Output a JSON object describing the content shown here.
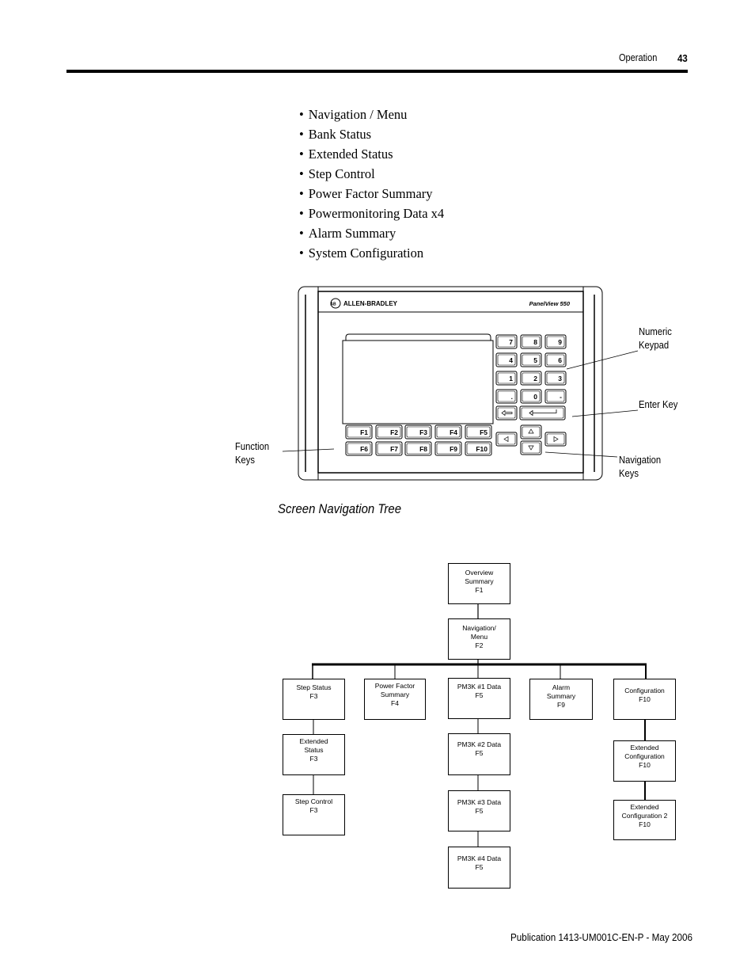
{
  "header": {
    "section": "Operation",
    "page_number": "43"
  },
  "bullet_list": [
    "Navigation / Menu",
    "Bank Status",
    "Extended Status",
    "Step Control",
    "Power Factor Summary",
    "Powermonitoring Data x4",
    "Alarm Summary",
    "System Configuration"
  ],
  "device": {
    "brand": "ALLEN-BRADLEY",
    "brand_logo": "AB",
    "model": "PanelView 550",
    "numeric_keys": [
      "7",
      "8",
      "9",
      "4",
      "5",
      "6",
      "1",
      "2",
      "3",
      ".",
      "0",
      "-"
    ],
    "function_keys_row1": [
      "F1",
      "F2",
      "F3",
      "F4",
      "F5"
    ],
    "function_keys_row2": [
      "F6",
      "F7",
      "F8",
      "F9",
      "F10"
    ],
    "icons": {
      "backspace": "left-arrow-icon",
      "enter": "enter-arrow-icon",
      "up": "up-triangle-icon",
      "down": "down-triangle-icon",
      "left": "left-triangle-icon",
      "right": "right-triangle-icon"
    },
    "callouts": {
      "numeric_keypad": [
        "Numeric",
        "Keypad"
      ],
      "enter_key": "Enter Key",
      "function_keys": [
        "Function",
        "Keys"
      ],
      "navigation_keys": [
        "Navigation",
        "Keys"
      ]
    }
  },
  "caption": "Screen Navigation Tree",
  "tree": {
    "root": [
      "Overview",
      "Summary",
      "F1"
    ],
    "menu": [
      "Navigation/",
      "Menu",
      "F2"
    ],
    "step_status": [
      "Step Status",
      "F3"
    ],
    "extended_status": [
      "Extended",
      "Status",
      "F3"
    ],
    "step_control": [
      "Step Control",
      "F3"
    ],
    "power_factor": [
      "Power Factor",
      "Summary",
      "F4"
    ],
    "pm1": [
      "PM3K #1 Data",
      "F5"
    ],
    "pm2": [
      "PM3K #2 Data",
      "F5"
    ],
    "pm3": [
      "PM3K #3 Data",
      "F5"
    ],
    "pm4": [
      "PM3K #4 Data",
      "F5"
    ],
    "alarm": [
      "Alarm",
      "Summary",
      "F9"
    ],
    "config": [
      "Configuration",
      "F10"
    ],
    "ext_config": [
      "Extended",
      "Configuration",
      "F10"
    ],
    "ext_config2": [
      "Extended",
      "Configuration 2",
      "F10"
    ]
  },
  "footer": "Publication 1413-UM001C-EN-P - May 2006"
}
